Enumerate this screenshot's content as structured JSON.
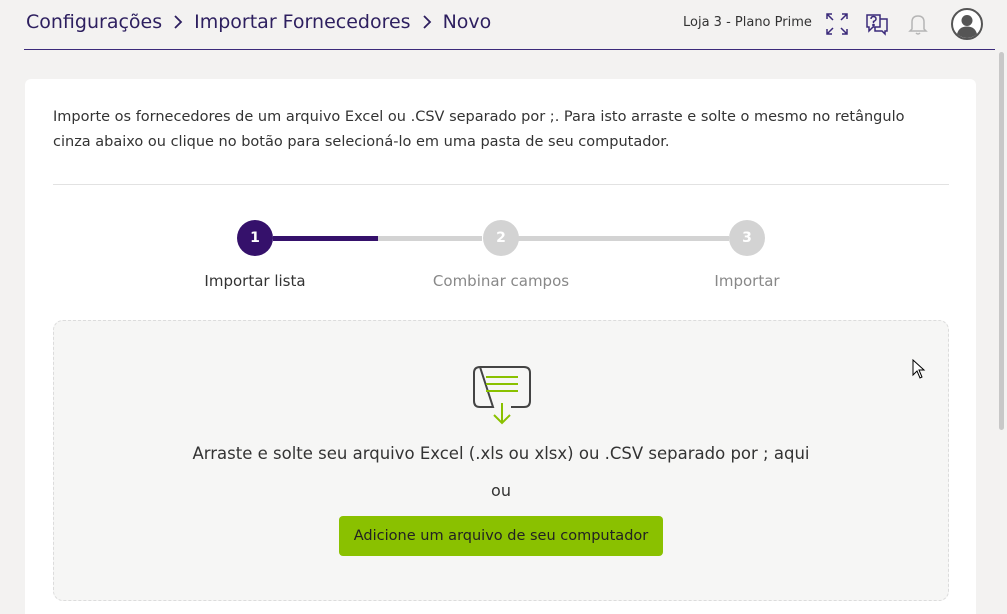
{
  "header": {
    "breadcrumb": [
      "Configurações",
      "Importar Fornecedores",
      "Novo"
    ],
    "store_label": "Loja 3 - Plano Prime",
    "icons": [
      "fullscreen-icon",
      "help-icon",
      "bell-icon",
      "user-avatar-icon"
    ]
  },
  "main": {
    "intro_text": "Importe os fornecedores de um arquivo Excel ou .CSV separado por ;. Para isto arraste e solte o mesmo no retângulo cinza abaixo ou clique no botão para selecioná-lo em uma pasta de seu computador.",
    "steps": [
      {
        "number": "1",
        "label": "Importar lista",
        "active": true
      },
      {
        "number": "2",
        "label": "Combinar campos",
        "active": false
      },
      {
        "number": "3",
        "label": "Importar",
        "active": false
      }
    ],
    "dropzone": {
      "icon": "file-download-icon",
      "text": "Arraste e solte seu arquivo Excel (.xls ou xlsx) ou .CSV separado por ; aqui",
      "or_text": "ou",
      "button_label": "Adicione um arquivo de seu computador"
    }
  },
  "colors": {
    "primary": "#35116b",
    "accent_green": "#8ac100",
    "inactive": "#d3d3d3"
  }
}
